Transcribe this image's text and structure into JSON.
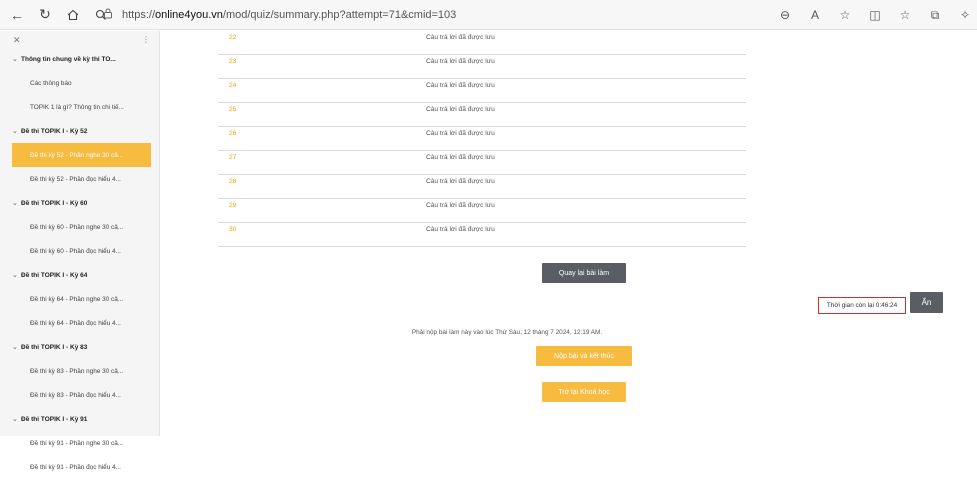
{
  "browser": {
    "url_prefix": "https://",
    "url_host": "online4you.vn",
    "url_path": "/mod/quiz/summary.php?attempt=71&cmid=103"
  },
  "sidebar": {
    "sections": [
      {
        "title": "Thông tin chung về kỳ thi TO...",
        "items": [
          "Các thông báo",
          "TOPIK 1 là gì? Thông tin chi tiế..."
        ]
      },
      {
        "title": "Đề thi TOPIK I - Kỳ 52",
        "items": [
          "Đề thi kỳ 52 - Phần nghe 30 câ...",
          "Đề thi kỳ 52 - Phần đọc hiểu 4..."
        ]
      },
      {
        "title": "Đề thi TOPIK I - Kỳ 60",
        "items": [
          "Đề thi kỳ 60 - Phần nghe 30 câ...",
          "Đề thi kỳ 60 - Phần đọc hiểu 4..."
        ]
      },
      {
        "title": "Đề thi TOPIK I - Kỳ 64",
        "items": [
          "Đề thi kỳ 64 - Phần nghe 30 câ...",
          "Đề thi kỳ 64 - Phần đọc hiểu 4..."
        ]
      },
      {
        "title": "Đề thi TOPIK I - Kỳ 83",
        "items": [
          "Đề thi kỳ 83 - Phần nghe 30 câ...",
          "Đề thi kỳ 83 - Phần đọc hiểu 4..."
        ]
      },
      {
        "title": "Đề thi TOPIK I - Kỳ 91",
        "items": [
          "Đề thi kỳ 91 - Phần nghe 30 câ...",
          "Đề thi kỳ 91 - Phần đọc hiểu 4..."
        ]
      }
    ],
    "active_item": "Đề thi kỳ 52 - Phần nghe 30 câ..."
  },
  "summary": {
    "rows": [
      {
        "number": "22",
        "status": "Câu trả lời đã được lưu"
      },
      {
        "number": "23",
        "status": "Câu trả lời đã được lưu"
      },
      {
        "number": "24",
        "status": "Câu trả lời đã được lưu"
      },
      {
        "number": "25",
        "status": "Câu trả lời đã được lưu"
      },
      {
        "number": "26",
        "status": "Câu trả lời đã được lưu"
      },
      {
        "number": "27",
        "status": "Câu trả lời đã được lưu"
      },
      {
        "number": "28",
        "status": "Câu trả lời đã được lưu"
      },
      {
        "number": "29",
        "status": "Câu trả lời đã được lưu"
      },
      {
        "number": "30",
        "status": "Câu trả lời đã được lưu"
      }
    ],
    "return_button": "Quay lại bài làm",
    "timer_text": "Thời gian còn lại 0:46:24",
    "hide_button": "Ẩn",
    "due_message": "Phải nộp bài làm này vào lúc Thứ Sáu, 12 tháng 7 2024, 12:19 AM.",
    "submit_button": "Nộp bài và kết thúc",
    "back_course_button": "Trở lại Khoá học"
  },
  "colors": {
    "accent": "#f6bb3f",
    "number_link": "#f2a007",
    "dark_button": "#5a5d63",
    "timer_border": "#c9302c"
  }
}
